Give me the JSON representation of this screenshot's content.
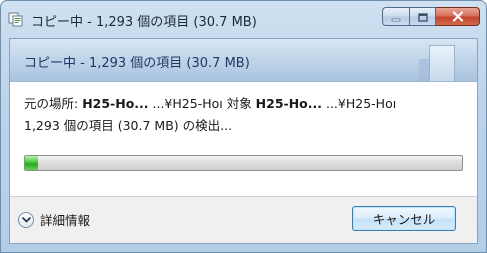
{
  "window": {
    "title": "コピー中 - 1,293 個の項目 (30.7 MB)"
  },
  "header": {
    "text": "コピー中 - 1,293 個の項目 (30.7 MB)"
  },
  "transfer": {
    "source_label": "元の場所: ",
    "source_name": "H25-Ho...",
    "source_path": " ...¥H25-Hoı",
    "dest_label": " 対象 ",
    "dest_name": "H25-Ho...",
    "dest_path": " ...¥H25-Hoı",
    "status": "1,293 個の項目 (30.7 MB) の検出..."
  },
  "progress": {
    "fraction": 0.03
  },
  "footer": {
    "details_label": "詳細情報",
    "cancel_label": "キャンセル"
  },
  "colors": {
    "progress_fill": "#3cb932",
    "header_text": "#1c3a63",
    "close_button": "#c2442a"
  },
  "icons": {
    "title": "copy-progress-icon",
    "minimize": "minimize-icon",
    "maximize": "maximize-icon",
    "close": "close-icon",
    "details": "chevron-down-icon"
  }
}
